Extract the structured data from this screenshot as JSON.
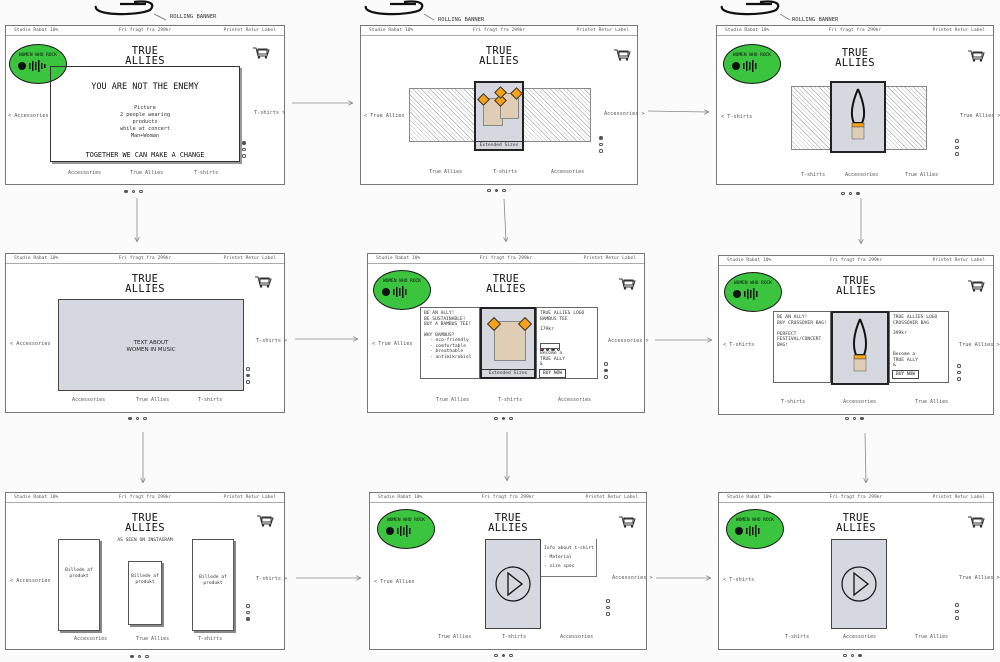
{
  "top": {
    "rolling_banner": "ROLLING BANNER"
  },
  "banner": {
    "left": "Studie Rabat 10%",
    "mid": "Fri fragt fra 299kr",
    "right": "Printet Retur Label"
  },
  "brand": {
    "title_line1": "TRUE",
    "title_line2": "ALLIES",
    "logo_text": "WOMEN WHO ROCK"
  },
  "nav": {
    "accessories": "Accessories",
    "tshirts": "T-shirts",
    "true_allies": "True Allies"
  },
  "frame1": {
    "headline": "YOU ARE NOT THE ENEMY",
    "picture_note": [
      "Picture",
      "2 people wearing",
      "products",
      "while at concert",
      "Man+Woman"
    ],
    "tagline": "TOGETHER WE CAN MAKE A CHANGE"
  },
  "frame2": {
    "extended_sizes": "Extended Sizes"
  },
  "frame4": {
    "text_about": [
      "TEXT ABOUT",
      "WOMEN IN MUSIC"
    ]
  },
  "frame5": {
    "left_text": [
      "BE AN ALLY!",
      "BE SUSTAINABLE!",
      "BUY A BAMBUS TEE!"
    ],
    "why": "WHY BAMBUS?",
    "reasons": [
      "- eco-friendly",
      "- comfortable",
      "- breathable",
      "- antimikrobiel"
    ],
    "product_name": [
      "TRUE ALLIES LOGO",
      "BAMBUS TEE"
    ],
    "price": "179kr",
    "become": [
      "Become a",
      "TRUE ALLY",
      "&"
    ],
    "buy_now": "BUY NOW",
    "extended_sizes": "Extended Sizes"
  },
  "frame6": {
    "left_text": [
      "BE AN ALLY!",
      "BUY CROSSOVER BAG!",
      "",
      "PERFECT",
      "FESTIVAL/CONCERT BAG!"
    ],
    "product_name": [
      "TRUE ALLIES LOGO",
      "CROSSOVER BAG"
    ],
    "price": "399kr",
    "become": [
      "Become a",
      "TRUE ALLY",
      "&"
    ],
    "buy_now": "BUY NOW"
  },
  "frame7": {
    "seen_on": "AS SEEN ON INSTAGRAM",
    "product_label": [
      "Billede af",
      "produkt"
    ]
  },
  "frame8": {
    "info": [
      "Info about t-shirt",
      "- Material",
      "- size spec"
    ]
  },
  "colors": {
    "logo_green": "#3bc43e",
    "product_gray": "#d5d9df",
    "accent_orange": "#f5a11b",
    "tee_beige": "#dfcdb6"
  }
}
